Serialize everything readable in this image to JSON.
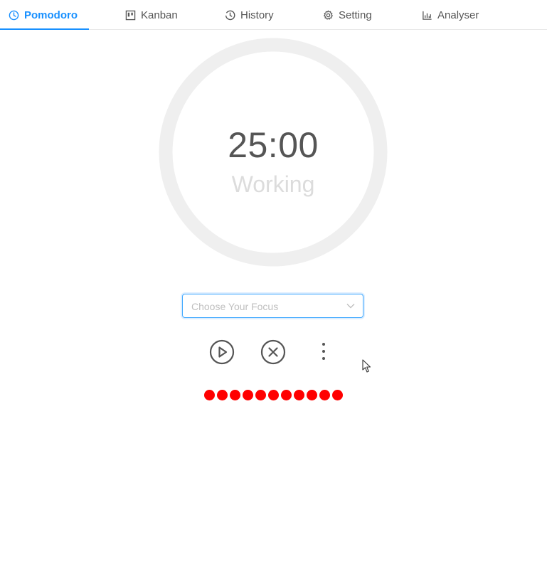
{
  "tabs": [
    {
      "id": "pomodoro",
      "label": "Pomodoro",
      "icon": "clock-icon",
      "active": true
    },
    {
      "id": "kanban",
      "label": "Kanban",
      "icon": "kanban-icon",
      "active": false
    },
    {
      "id": "history",
      "label": "History",
      "icon": "history-icon",
      "active": false
    },
    {
      "id": "setting",
      "label": "Setting",
      "icon": "gear-icon",
      "active": false
    },
    {
      "id": "analyser",
      "label": "Analyser",
      "icon": "bar-chart-icon",
      "active": false
    }
  ],
  "timer": {
    "time": "25:00",
    "status": "Working",
    "progress": 0
  },
  "focus": {
    "placeholder": "Choose Your Focus",
    "value": ""
  },
  "controls": {
    "play_icon": "play-icon",
    "stop_icon": "close-icon",
    "more_icon": "more-vertical-icon"
  },
  "pomodoro_dots": {
    "count": 11,
    "color": "#ff0000"
  },
  "colors": {
    "accent": "#1890ff",
    "ring": "#efefef",
    "text": "#555555",
    "status": "#dcdcdc"
  }
}
